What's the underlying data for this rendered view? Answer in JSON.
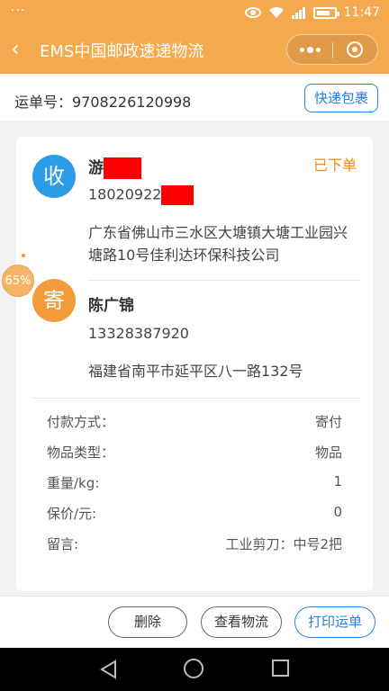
{
  "status_bar": {
    "left_indicator": "···",
    "network": "4G 2G",
    "time": "11:47"
  },
  "navbar": {
    "title": "EMS中国邮政速递物流",
    "back_icon": "chevron-left-icon",
    "more_icon": "more-dots-icon",
    "close_icon": "target-close-icon"
  },
  "order": {
    "number_label": "运单号：",
    "number": "9708226120998",
    "type_chip": "快递包裹"
  },
  "receiver": {
    "avatar": "收",
    "name": "游",
    "phone": "18020922",
    "address": "广东省佛山市三水区大塘镇大塘工业园兴塘路10号佳利达环保科技公司",
    "status": "已下单"
  },
  "sender": {
    "avatar": "寄",
    "name": "陈广锦",
    "phone": "13328387920",
    "address": "福建省南平市延平区八一路132号"
  },
  "details": [
    {
      "label": "付款方式：",
      "value": "寄付"
    },
    {
      "label": "物品类型：",
      "value": "物品"
    },
    {
      "label": "重量/kg:",
      "value": "1"
    },
    {
      "label": "保价/元:",
      "value": "0"
    },
    {
      "label": "留言:",
      "value": "工业剪刀：中号2把"
    }
  ],
  "floating_badge": "65%",
  "actions": {
    "delete": "删除",
    "track": "查看物流",
    "print": "打印运单"
  },
  "colors": {
    "header": "#f5a94f",
    "accent_blue": "#2a7fd6",
    "status_orange": "#f08c10",
    "receiver_avatar": "#2a9de6",
    "sender_avatar": "#f39a3a"
  }
}
